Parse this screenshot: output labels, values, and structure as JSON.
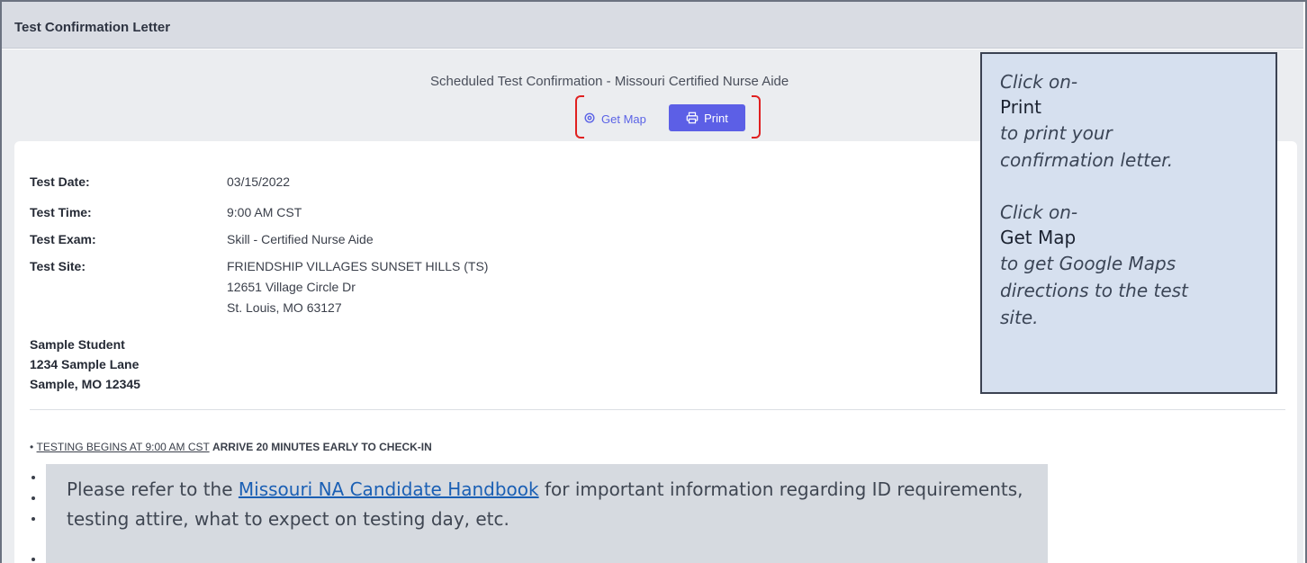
{
  "header": {
    "title": "Test Confirmation Letter"
  },
  "confirmation": {
    "title": "Scheduled Test Confirmation - Missouri Certified Nurse Aide",
    "get_map_label": "Get Map",
    "print_label": "Print"
  },
  "details": {
    "date_label": "Test Date:",
    "date_value": "03/15/2022",
    "time_label": "Test Time:",
    "time_value": "9:00 AM CST",
    "exam_label": "Test Exam:",
    "exam_value": "Skill - Certified Nurse Aide",
    "site_label": "Test Site:",
    "site_line1": "FRIENDSHIP VILLAGES SUNSET HILLS (TS)",
    "site_line2": "12651 Village Circle Dr",
    "site_line3": "St. Louis, MO 63127"
  },
  "student": {
    "name": "Sample Student",
    "street": "1234 Sample Lane",
    "city": "Sample, MO 12345"
  },
  "bullets": {
    "first_underlined": "TESTING BEGINS AT 9:00 AM CST",
    "first_bold": "ARRIVE 20 MINUTES EARLY TO CHECK-IN"
  },
  "callout_right": {
    "line1": "Click on-",
    "print_kw": "Print",
    "line3": "to print your",
    "line4": "confirmation letter.",
    "line5": "Click on-",
    "map_kw": "Get Map",
    "line7": "to get Google Maps",
    "line8": "directions to the test",
    "line9": "site."
  },
  "callout_bottom": {
    "prefix": "Please refer to the ",
    "link": "Missouri NA Candidate Handbook",
    "suffix": " for important information regarding ID requirements,",
    "line2": "testing attire, what to expect on testing day, etc."
  },
  "colors": {
    "accent": "#5c5fe6",
    "highlight": "#e02020",
    "callout": "#d6e0ef"
  }
}
